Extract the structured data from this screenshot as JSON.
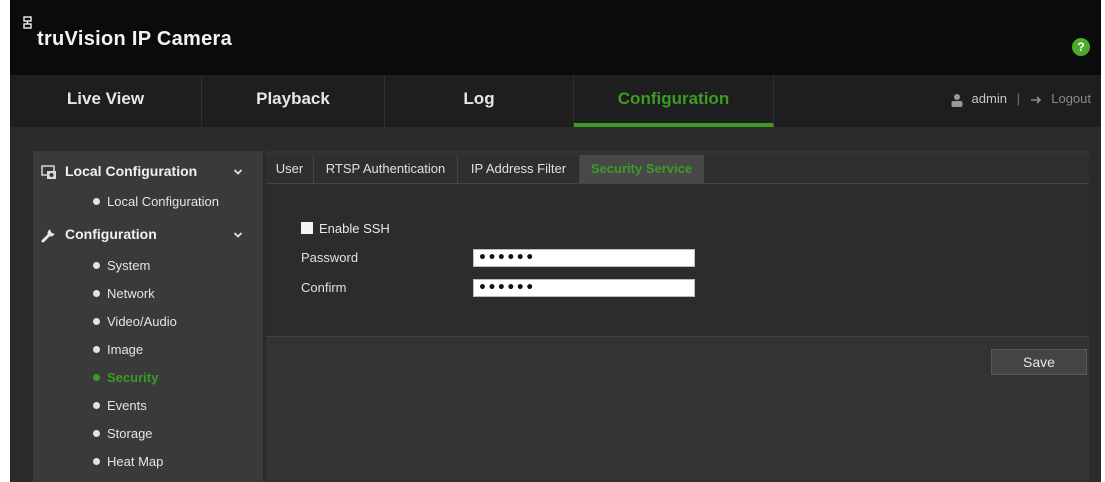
{
  "header": {
    "title": "truVision IP Camera",
    "help_icon": "help-icon",
    "help_glyph": "?",
    "accent_color": "#3c9b25"
  },
  "nav": {
    "tabs": [
      {
        "label": "Live View"
      },
      {
        "label": "Playback"
      },
      {
        "label": "Log"
      },
      {
        "label": "Configuration",
        "active": true
      }
    ],
    "user": "admin",
    "separator": "|",
    "logout": "Logout"
  },
  "sidebar": {
    "groups": [
      {
        "label": "Local Configuration",
        "icon": "local-config-icon",
        "items": [
          "Local Configuration"
        ]
      },
      {
        "label": "Configuration",
        "icon": "wrench-icon",
        "items": [
          "System",
          "Network",
          "Video/Audio",
          "Image",
          "Security",
          "Events",
          "Storage",
          "Heat Map"
        ]
      }
    ],
    "active_item": "Security"
  },
  "content": {
    "tabs": [
      {
        "label": "User"
      },
      {
        "label": "RTSP Authentication"
      },
      {
        "label": "IP Address Filter"
      },
      {
        "label": "Security Service",
        "active": true
      }
    ],
    "enable_ssh": {
      "label": "Enable SSH",
      "checked": false
    },
    "password": {
      "label": "Password",
      "value": "••••••"
    },
    "confirm": {
      "label": "Confirm",
      "value": "••••••"
    },
    "save_label": "Save"
  }
}
